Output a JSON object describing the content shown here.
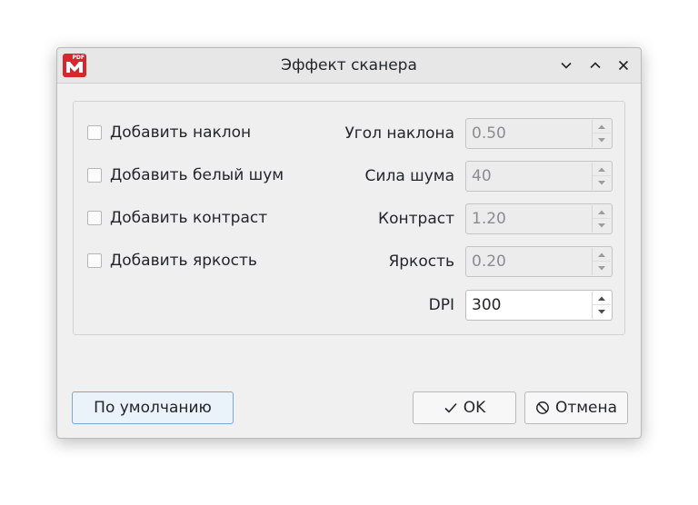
{
  "window": {
    "title": "Эффект сканера",
    "app_icon_badge": "PDF",
    "accent_color": "#d8262e"
  },
  "options": [
    {
      "label": "Добавить наклон",
      "checked": false
    },
    {
      "label": "Добавить белый шум",
      "checked": false
    },
    {
      "label": "Добавить контраст",
      "checked": false
    },
    {
      "label": "Добавить яркость",
      "checked": false
    }
  ],
  "fields": [
    {
      "label": "Угол наклона",
      "value": "0.50",
      "enabled": false
    },
    {
      "label": "Сила шума",
      "value": "40",
      "enabled": false
    },
    {
      "label": "Контраст",
      "value": "1.20",
      "enabled": false
    },
    {
      "label": "Яркость",
      "value": "0.20",
      "enabled": false
    },
    {
      "label": "DPI",
      "value": "300",
      "enabled": true
    }
  ],
  "buttons": {
    "defaults": "По умолчанию",
    "ok": "OK",
    "cancel": "Отмена"
  }
}
